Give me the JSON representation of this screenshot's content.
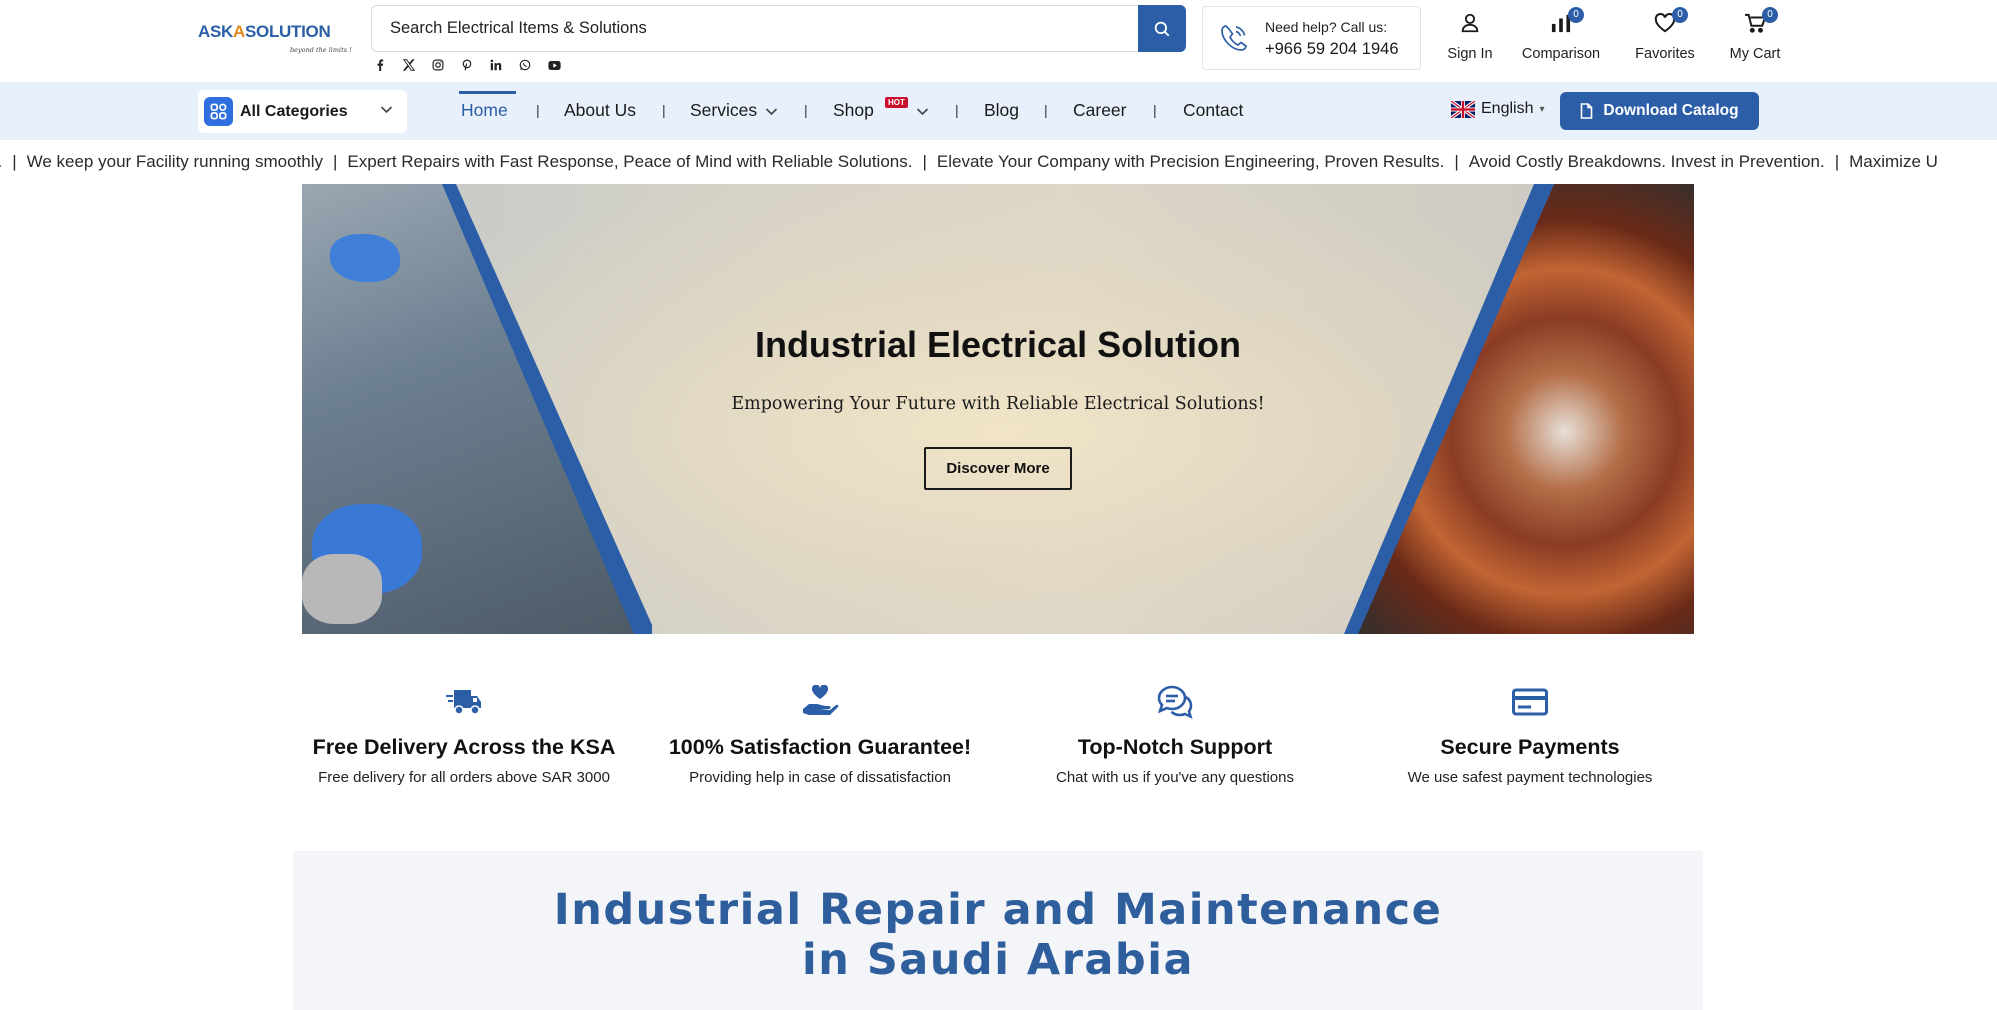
{
  "logo": {
    "brand_part1": "ASK",
    "brand_mark": "A",
    "brand_part2": "SOLUTION",
    "tagline": "beyond the limits !"
  },
  "search": {
    "placeholder": "Search Electrical Items & Solutions",
    "value": ""
  },
  "socials": [
    "facebook-icon",
    "x-icon",
    "instagram-icon",
    "pinterest-icon",
    "linkedin-icon",
    "whatsapp-icon",
    "youtube-icon"
  ],
  "help": {
    "label": "Need help? Call us:",
    "number": "+966 59 204 1946"
  },
  "header_actions": {
    "sign_in": "Sign In",
    "comparison": "Comparison",
    "comparison_count": "0",
    "favorites": "Favorites",
    "favorites_count": "0",
    "cart": "My Cart",
    "cart_count": "0"
  },
  "nav": {
    "categories": "All Categories",
    "items": [
      "Home",
      "About Us",
      "Services",
      "Shop",
      "Blog",
      "Career",
      "Contact"
    ],
    "hot_badge": "HOT",
    "separator": "|",
    "language": "English",
    "download": "Download Catalog"
  },
  "ticker": [
    "e.",
    "We keep your Facility running smoothly",
    "Expert Repairs with Fast Response, Peace of Mind with Reliable Solutions.",
    "Elevate Your Company with Precision Engineering, Proven Results.",
    "Avoid Costly Breakdowns. Invest in Prevention.",
    "Maximize U"
  ],
  "hero": {
    "title": "Industrial Electrical Solution",
    "subtitle": "Empowering Your Future with Reliable Electrical Solutions!",
    "cta": "Discover More"
  },
  "features": [
    {
      "icon": "delivery-truck-icon",
      "title": "Free Delivery Across the KSA",
      "subtitle": "Free delivery for all orders above SAR 3000"
    },
    {
      "icon": "hand-heart-icon",
      "title": "100% Satisfaction Guarantee!",
      "subtitle": "Providing help in case of dissatisfaction"
    },
    {
      "icon": "chat-support-icon",
      "title": "Top-Notch Support",
      "subtitle": "Chat with us if you've any questions"
    },
    {
      "icon": "credit-card-icon",
      "title": "Secure Payments",
      "subtitle": "We use safest payment technologies"
    }
  ],
  "section": {
    "title_line1": "Industrial Repair and Maintenance",
    "title_line2": "in Saudi Arabia"
  },
  "colors": {
    "accent": "#2c5ea8",
    "nav_bg": "#e8f0fb",
    "hot": "#c8102e",
    "section_title": "#2f5e9d"
  }
}
